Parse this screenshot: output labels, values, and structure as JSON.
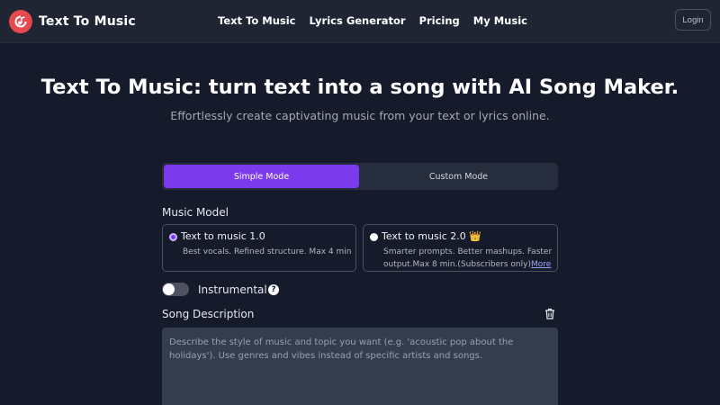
{
  "header": {
    "brand": "Text To Music",
    "nav": [
      "Text To Music",
      "Lyrics Generator",
      "Pricing",
      "My Music"
    ],
    "login_label": "Login"
  },
  "hero": {
    "title": "Text To Music: turn text into a song with AI Song Maker.",
    "subtitle": "Effortlessly create captivating music from your text or lyrics online."
  },
  "modes": {
    "simple": "Simple Mode",
    "custom": "Custom Mode",
    "selected": "Simple Mode"
  },
  "music_model": {
    "label": "Music Model",
    "options": [
      {
        "title": "Text to music 1.0",
        "desc": "Best vocals. Refined structure. Max 4 min",
        "selected": true
      },
      {
        "title": "Text to music 2.0 👑",
        "desc_line1": "Smarter prompts. Better mashups. Faster",
        "desc_line2": "output.Max 8 min.(Subscribers only)",
        "more": "More",
        "selected": false
      }
    ]
  },
  "instrumental": {
    "label": "Instrumental",
    "enabled": false,
    "help_glyph": "?"
  },
  "song_description": {
    "label": "Song Description",
    "placeholder": "Describe the style of music and topic you want (e.g. 'acoustic pop about the holidays'). Use genres and vibes instead of specific artists and songs.",
    "value": ""
  },
  "colors": {
    "background": "#161b2b",
    "header": "#1f2533",
    "accent": "#7c3aed",
    "logo": "#e5484d"
  },
  "icons": {
    "logo": "music-note-icon",
    "help": "question-circle-icon",
    "clear": "trash-icon"
  }
}
